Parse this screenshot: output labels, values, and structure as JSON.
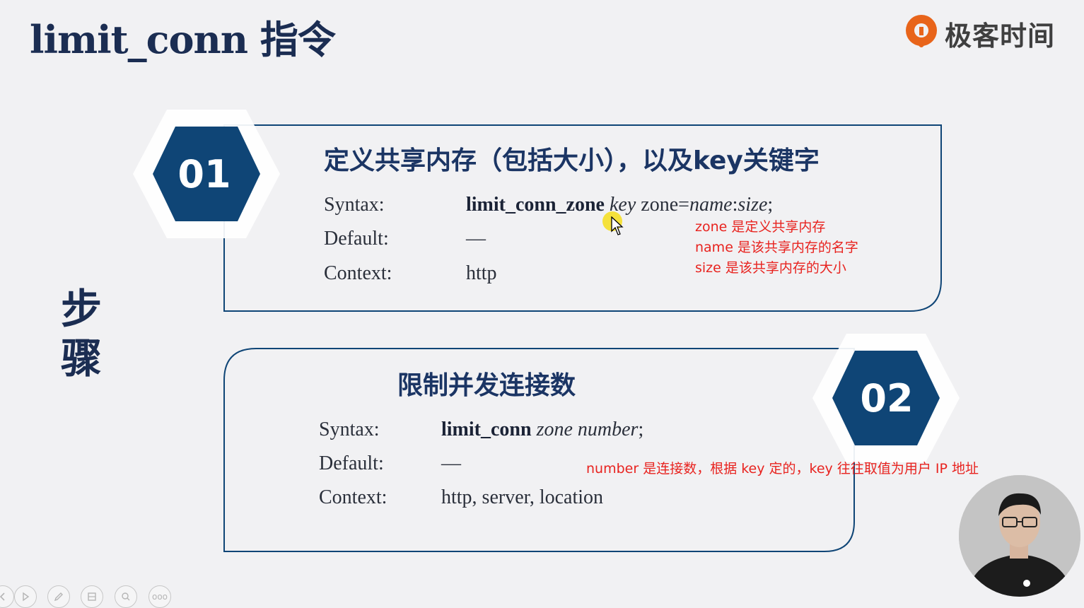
{
  "slide": {
    "title": "limit_conn 指令",
    "steps_label": "步\n骤"
  },
  "brand": {
    "name": "极客时间",
    "logo_icon": "geektime-logo-icon",
    "accent_color": "#e8641a"
  },
  "colors": {
    "navy": "#0f4576",
    "title_navy": "#1b2d52",
    "annotation_red": "#e8231f",
    "cursor_highlight": "#f6de1a"
  },
  "step1": {
    "number": "01",
    "title": "定义共享内存（包括大小），以及key关键字",
    "rows": {
      "syntax_label": "Syntax:",
      "syntax_keyword": "limit_conn_zone",
      "syntax_arg_key": "key",
      "syntax_zone_eq": "zone=",
      "syntax_name": "name",
      "syntax_colon": ":",
      "syntax_size": "size",
      "syntax_end": ";",
      "default_label": "Default:",
      "default_value": "—",
      "context_label": "Context:",
      "context_value": "http"
    },
    "notes": [
      "zone 是定义共享内存",
      "name 是该共享内存的名字",
      "size 是该共享内存的大小"
    ]
  },
  "step2": {
    "number": "02",
    "title": "限制并发连接数",
    "rows": {
      "syntax_label": "Syntax:",
      "syntax_keyword": "limit_conn",
      "syntax_args": "zone number",
      "syntax_end": ";",
      "default_label": "Default:",
      "default_value": "—",
      "context_label": "Context:",
      "context_value": "http, server, location"
    },
    "note": "number 是连接数，根据 key 定的，key 往往取值为用户 IP 地址"
  },
  "toolbar": {
    "buttons": [
      {
        "icon": "back-icon"
      },
      {
        "icon": "play-icon"
      },
      {
        "icon": "pen-icon"
      },
      {
        "icon": "slides-icon"
      },
      {
        "icon": "zoom-icon"
      },
      {
        "icon": "more-icon",
        "label": "ooo"
      }
    ]
  }
}
